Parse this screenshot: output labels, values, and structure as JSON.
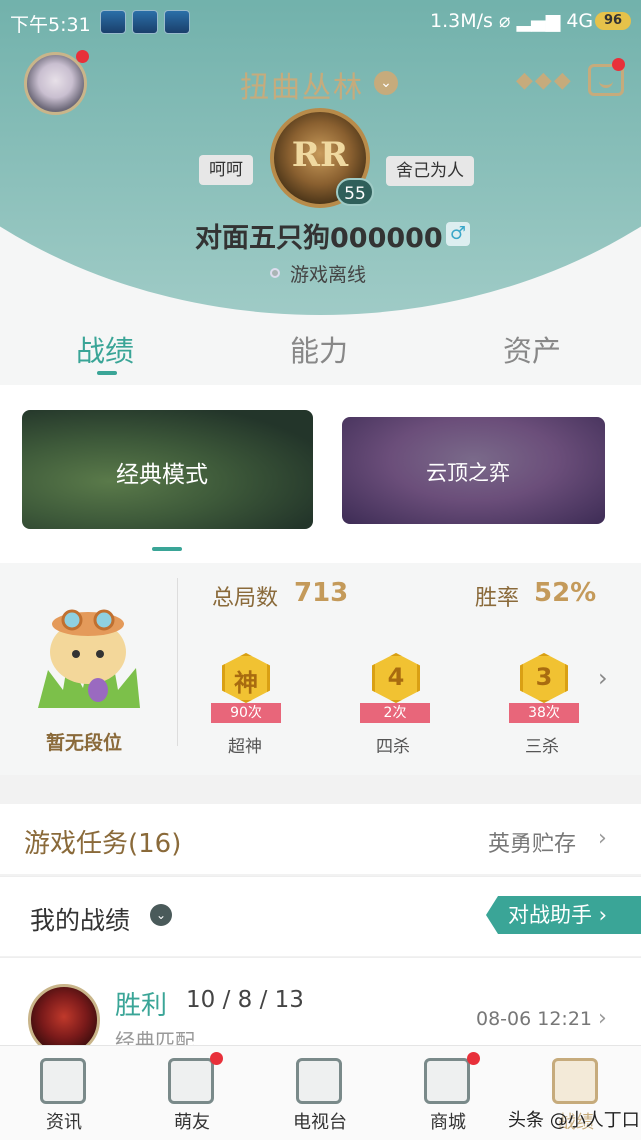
{
  "status_bar": {
    "time": "下午5:31",
    "network": "1.3M/s",
    "signal": "4G",
    "battery": "96"
  },
  "header": {
    "region": "扭曲丛林",
    "tag_left": "呵呵",
    "tag_right": "舍己为人",
    "badge_text": "RR",
    "level": "55",
    "player_name": "对面五只狗000000",
    "gender_symbol": "♂",
    "presence": "游戏离线",
    "more_label": "◆◆◆"
  },
  "tabs": [
    {
      "label": "战绩"
    },
    {
      "label": "能力"
    },
    {
      "label": "资产"
    }
  ],
  "modes": [
    {
      "label": "经典模式"
    },
    {
      "label": "云顶之弈"
    }
  ],
  "stats": {
    "rank": "暂无段位",
    "total_games_label": "总局数",
    "total_games": "713",
    "win_rate_label": "胜率",
    "win_rate": "52%",
    "medals": [
      {
        "glyph": "神",
        "count": "90次",
        "name": "超神"
      },
      {
        "glyph": "4",
        "count": "2次",
        "name": "四杀"
      },
      {
        "glyph": "3",
        "count": "38次",
        "name": "三杀"
      }
    ]
  },
  "tasks": {
    "title": "游戏任务(16)",
    "right_link": "英勇贮存"
  },
  "records": {
    "title": "我的战绩",
    "assist_button": "对战助手"
  },
  "match": {
    "result": "胜利",
    "kda": "10 / 8 / 13",
    "type": "经典匹配",
    "time": "08-06 12:21"
  },
  "nav": [
    {
      "label": "资讯",
      "icon": "news-icon"
    },
    {
      "label": "萌友",
      "icon": "friends-icon"
    },
    {
      "label": "电视台",
      "icon": "tv-icon"
    },
    {
      "label": "商城",
      "icon": "shop-icon"
    },
    {
      "label": "战绩",
      "icon": "records-icon"
    }
  ],
  "watermark": "头条 @小人丁口",
  "colors": {
    "accent": "#3aa597",
    "gold": "#c6ab7c",
    "header_teal": "#3c8f88"
  }
}
